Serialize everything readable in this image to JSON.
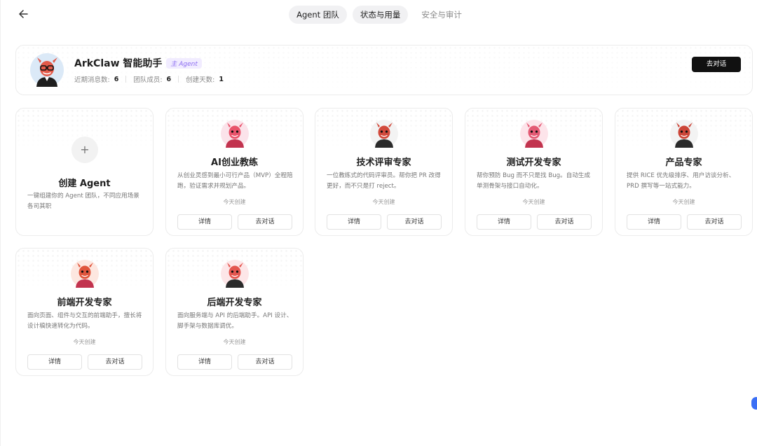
{
  "nav": {
    "back_icon": "arrow-left-icon",
    "tabs": [
      {
        "label": "Agent 团队",
        "active": true
      },
      {
        "label": "状态与用量",
        "active": true
      },
      {
        "label": "安全与审计",
        "active": false
      }
    ]
  },
  "hero": {
    "title": "ArkClaw 智能助手",
    "tag": "主 Agent",
    "stats": [
      {
        "label": "近期消息数:",
        "value": "6"
      },
      {
        "label": "团队成员:",
        "value": "6"
      },
      {
        "label": "创建天数:",
        "value": "1"
      }
    ],
    "chat_label": "去对话"
  },
  "create_card": {
    "plus": "+",
    "title": "创建 Agent",
    "desc": "一键组建你的 Agent 团队，不同应用场景各司其职"
  },
  "agents": [
    {
      "title": "AI创业教练",
      "desc": "从创业灵感到最小可行产品（MVP）全程陪跑，验证需求并规划产品。",
      "created": "今天创建",
      "detail_label": "详情",
      "chat_label": "去对话",
      "color": "#e9536b"
    },
    {
      "title": "技术评审专家",
      "desc": "一位教练式的代码评审员。帮你把 PR 改得更好，而不只是打 reject。",
      "created": "今天创建",
      "detail_label": "详情",
      "chat_label": "去对话",
      "color": "#d24a3c"
    },
    {
      "title": "测试开发专家",
      "desc": "帮你预防 Bug 而不只是找 Bug。自动生成单测骨架与接口自动化。",
      "created": "今天创建",
      "detail_label": "详情",
      "chat_label": "去对话",
      "color": "#e45a74"
    },
    {
      "title": "产品专家",
      "desc": "提供 RICE 优先级排序、用户访谈分析、PRD 撰写等一站式能力。",
      "created": "今天创建",
      "detail_label": "详情",
      "chat_label": "去对话",
      "color": "#cc4538"
    },
    {
      "title": "前端开发专家",
      "desc": "面向页面、组件与交互的前端助手，擅长将设计稿快速转化为代码。",
      "created": "今天创建",
      "detail_label": "详情",
      "chat_label": "去对话",
      "color": "#e0553c"
    },
    {
      "title": "后端开发专家",
      "desc": "面向服务端与 API 的后端助手。API 设计、脚手架与数据库调优。",
      "created": "今天创建",
      "detail_label": "详情",
      "chat_label": "去对话",
      "color": "#e4564f"
    }
  ]
}
